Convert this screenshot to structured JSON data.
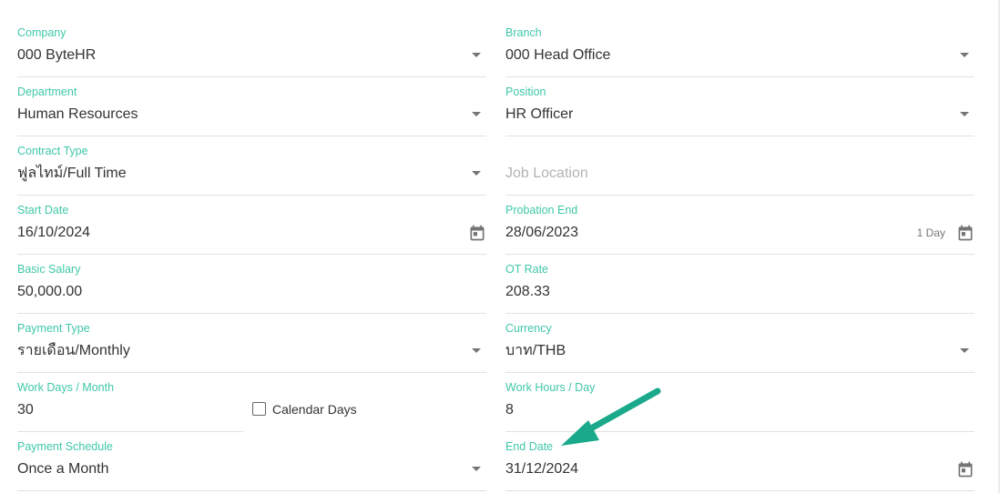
{
  "fields": {
    "company": {
      "label": "Company",
      "value": "000 ByteHR"
    },
    "branch": {
      "label": "Branch",
      "value": "000 Head Office"
    },
    "department": {
      "label": "Department",
      "value": "Human Resources"
    },
    "position": {
      "label": "Position",
      "value": "HR Officer"
    },
    "contract_type": {
      "label": "Contract Type",
      "value": "ฟูลไทม์/Full Time"
    },
    "job_location": {
      "label": "",
      "placeholder": "Job Location"
    },
    "start_date": {
      "label": "Start Date",
      "value": "16/10/2024"
    },
    "probation_end": {
      "label": "Probation End",
      "value": "28/06/2023",
      "extra": "1 Day"
    },
    "basic_salary": {
      "label": "Basic Salary",
      "value": "50,000.00"
    },
    "ot_rate": {
      "label": "OT Rate",
      "value": "208.33"
    },
    "payment_type": {
      "label": "Payment Type",
      "value": "รายเดือน/Monthly"
    },
    "currency": {
      "label": "Currency",
      "value": "บาท/THB"
    },
    "work_days_month": {
      "label": "Work Days / Month",
      "value": "30"
    },
    "calendar_days": {
      "label": "Calendar Days",
      "checked": false
    },
    "work_hours_day": {
      "label": "Work Hours / Day",
      "value": "8"
    },
    "payment_schedule": {
      "label": "Payment Schedule",
      "value": "Once a Month"
    },
    "end_date": {
      "label": "End Date",
      "value": "31/12/2024"
    }
  },
  "icons": {
    "dropdown": "caret-down-icon",
    "calendar": "calendar-icon",
    "annotation": "arrow-icon"
  },
  "colors": {
    "label": "#3fc8a8",
    "annotation_arrow": "#1aa98a"
  }
}
